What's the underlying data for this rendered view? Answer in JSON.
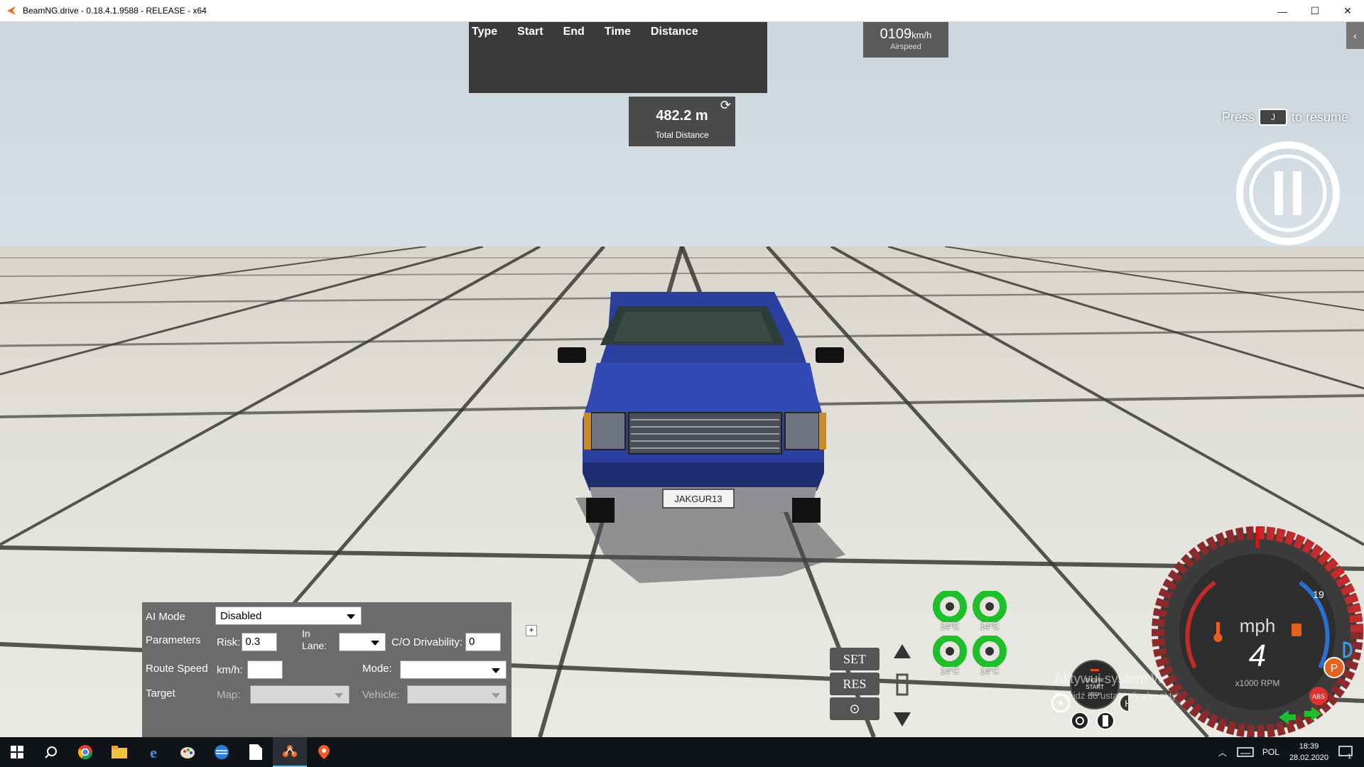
{
  "window": {
    "title": "BeamNG.drive - 0.18.4.1.9588 - RELEASE - x64",
    "minimize": "—",
    "maximize": "☐",
    "close": "✕"
  },
  "distance_table": {
    "columns": [
      "Type",
      "Start",
      "End",
      "Time",
      "Distance"
    ]
  },
  "total_distance": {
    "value": "482.2 m",
    "label": "Total Distance"
  },
  "airspeed": {
    "value": "0109",
    "unit": "km/h",
    "label": "Airspeed"
  },
  "resume": {
    "press": "Press",
    "key": "J",
    "suffix": "to resume"
  },
  "license_plate": "JAKGUR13",
  "ai_panel": {
    "ai_mode_label": "AI Mode",
    "ai_mode_value": "Disabled",
    "parameters_label": "Parameters",
    "risk_label": "Risk:",
    "risk_value": "0.3",
    "in_lane_label_1": "In",
    "in_lane_label_2": "Lane:",
    "in_lane_value": "",
    "drivability_label": "C/O Drivability:",
    "drivability_value": "0",
    "route_speed_label": "Route Speed",
    "kmh_label": "km/h:",
    "route_speed_value": "",
    "mode_label": "Mode:",
    "mode_value": "",
    "target_label": "Target",
    "map_label": "Map:",
    "map_value": "",
    "vehicle_label": "Vehicle:",
    "vehicle_value": "",
    "plus": "+"
  },
  "cruise": {
    "set": "SET",
    "res": "RES"
  },
  "tires": {
    "fl": "14°C",
    "fr": "14°C",
    "rl": "14°C",
    "rr": "14°C"
  },
  "engine_button": {
    "line1": "ENGINE",
    "line2": "START",
    "line3": "STOP"
  },
  "watermark": {
    "line1": "Aktywuj system Windows",
    "line2": "Przejdź do ustawień, aby aktywować system Windows."
  },
  "gauge": {
    "unit": "mph",
    "gear": "4",
    "rpm_label": "x1000 RPM",
    "max_label": "19",
    "parking": "P",
    "abs": "ABS"
  },
  "taskbar": {
    "language": "POL",
    "time": "18:39",
    "date": "28.02.2020"
  },
  "colors": {
    "car_body": "#2a3f9e",
    "panel_dark": "#3a3a3a",
    "gauge_red": "#c22b2b",
    "tire_green": "#1fbf2b"
  }
}
